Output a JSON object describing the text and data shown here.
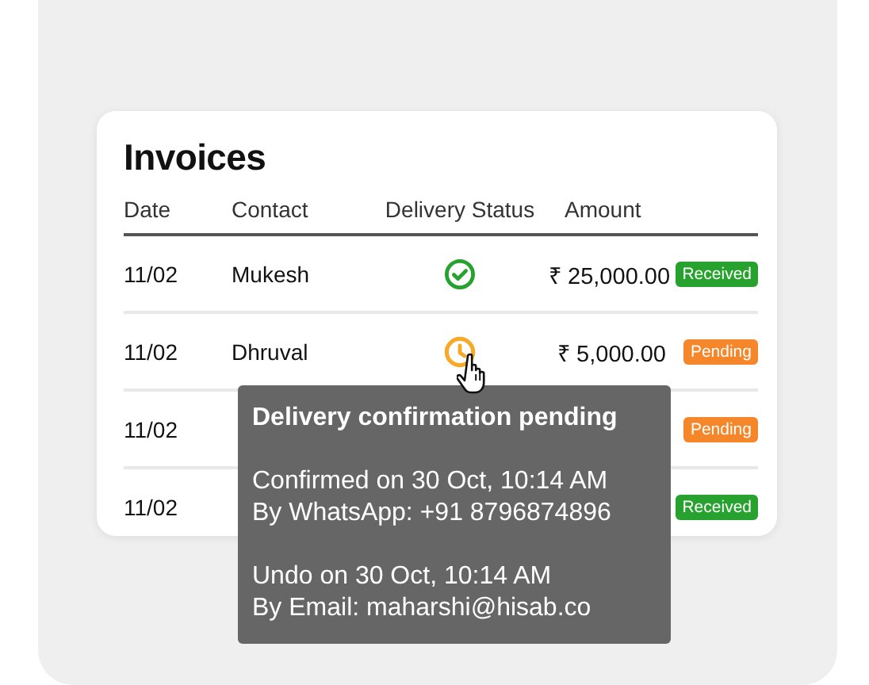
{
  "title": "Invoices",
  "columns": [
    "Date",
    "Contact",
    "Delivery Status",
    "Amount"
  ],
  "rows": [
    {
      "date": "11/02",
      "contact": "Mukesh",
      "delivered": true,
      "amount": "₹ 25,000.00",
      "status": {
        "label": "Received",
        "kind": "received"
      }
    },
    {
      "date": "11/02",
      "contact": "Dhruval",
      "delivered": false,
      "amount": "₹ 5,000.00",
      "status": {
        "label": "Pending",
        "kind": "pending"
      }
    },
    {
      "date": "11/02",
      "status": {
        "label": "Pending",
        "kind": "pending"
      }
    },
    {
      "date": "11/02",
      "status": {
        "label": "Received",
        "kind": "received"
      }
    }
  ],
  "tooltip": {
    "title": "Delivery confirmation pending",
    "sections": [
      [
        "Confirmed on 30 Oct, 10:14 AM",
        "By WhatsApp: +91 8796874896"
      ],
      [
        "Undo on 30 Oct, 10:14 AM",
        "By Email: maharshi@hisab.co"
      ]
    ]
  }
}
